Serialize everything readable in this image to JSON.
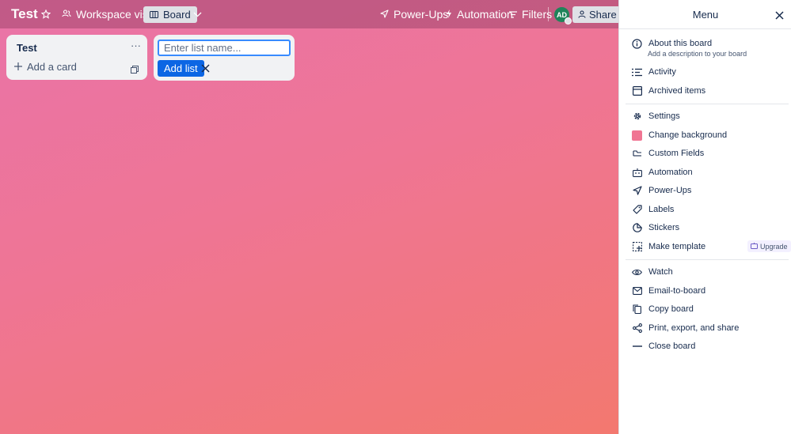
{
  "topbar": {
    "board_name": "Test",
    "visibility": "Workspace visible",
    "view": "Board",
    "powerups": "Power-Ups",
    "automation": "Automation",
    "filters": "Filters",
    "avatar_initials": "AD",
    "share": "Share"
  },
  "list": {
    "title": "Test",
    "add_card": "Add a card"
  },
  "new_list": {
    "placeholder": "Enter list name...",
    "add_button": "Add list"
  },
  "menu": {
    "title": "Menu",
    "about": {
      "label": "About this board",
      "sub": "Add a description to your board"
    },
    "items": [
      {
        "label": "Activity"
      },
      {
        "label": "Archived items"
      },
      {
        "label": "Settings"
      },
      {
        "label": "Change background"
      },
      {
        "label": "Custom Fields"
      },
      {
        "label": "Automation"
      },
      {
        "label": "Power-Ups"
      },
      {
        "label": "Labels"
      },
      {
        "label": "Stickers"
      },
      {
        "label": "Make template",
        "badge": "Upgrade"
      },
      {
        "label": "Watch"
      },
      {
        "label": "Email-to-board"
      },
      {
        "label": "Copy board"
      },
      {
        "label": "Print, export, and share"
      },
      {
        "label": "Close board"
      }
    ]
  },
  "colors": {
    "background_swatch": "#f07593",
    "primary_button": "#0c66e4",
    "avatar": "#1f845a"
  }
}
